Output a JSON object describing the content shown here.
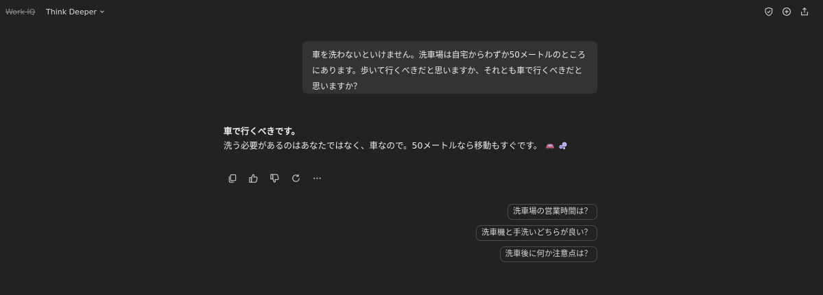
{
  "header": {
    "brand": "Work IQ",
    "mode_label": "Think Deeper",
    "actions": [
      "shield-check-icon",
      "new-chat-icon",
      "share-icon"
    ]
  },
  "conversation": {
    "user_message": "車を洗わないといけません。洗車場は自宅からわずか50メートルのところにあります。歩いて行くべきだと思いますか、それとも車で行くべきだと思いますか？",
    "assistant": {
      "title": "車で行くべきです。",
      "body": "洗う必要があるのはあなたではなく、車なので。50メートルなら移動もすぐです。",
      "emojis": [
        "car-emoji",
        "bubbles-emoji"
      ]
    },
    "feedback_actions": [
      "copy-icon",
      "thumbs-up-icon",
      "thumbs-down-icon",
      "regenerate-icon",
      "more-icon"
    ]
  },
  "suggestions": [
    "洗車場の営業時間は？",
    "洗車機と手洗いどちらが良い？",
    "洗車後に何か注意点は？"
  ],
  "colors": {
    "background": "#222222",
    "bubble": "#333333",
    "chip_border": "#4d4d4d"
  }
}
